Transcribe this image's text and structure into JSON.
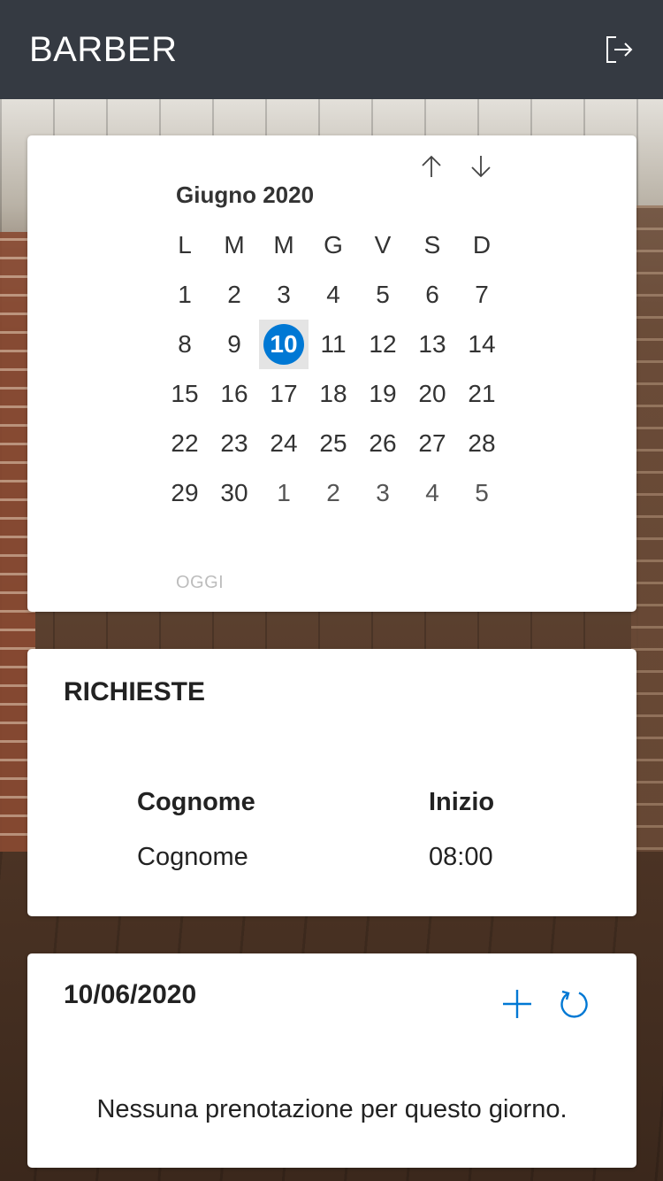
{
  "app": {
    "title": "BARBER"
  },
  "calendar": {
    "month_label": "Giugno 2020",
    "weekdays": [
      "L",
      "M",
      "M",
      "G",
      "V",
      "S",
      "D"
    ],
    "weeks": [
      [
        "1",
        "2",
        "3",
        "4",
        "5",
        "6",
        "7"
      ],
      [
        "8",
        "9",
        "10",
        "11",
        "12",
        "13",
        "14"
      ],
      [
        "15",
        "16",
        "17",
        "18",
        "19",
        "20",
        "21"
      ],
      [
        "22",
        "23",
        "24",
        "25",
        "26",
        "27",
        "28"
      ],
      [
        "29",
        "30",
        "1",
        "2",
        "3",
        "4",
        "5"
      ]
    ],
    "selected_day": "10",
    "today_label": "OGGI"
  },
  "requests": {
    "title": "RICHIESTE",
    "columns": [
      "Cognome",
      "Inizio"
    ],
    "rows": [
      [
        "Cognome",
        "08:00"
      ]
    ]
  },
  "day": {
    "date_label": "10/06/2020",
    "empty_message": "Nessuna prenotazione per questo giorno."
  },
  "colors": {
    "topbar": "#353a42",
    "accent": "#0078d4"
  }
}
